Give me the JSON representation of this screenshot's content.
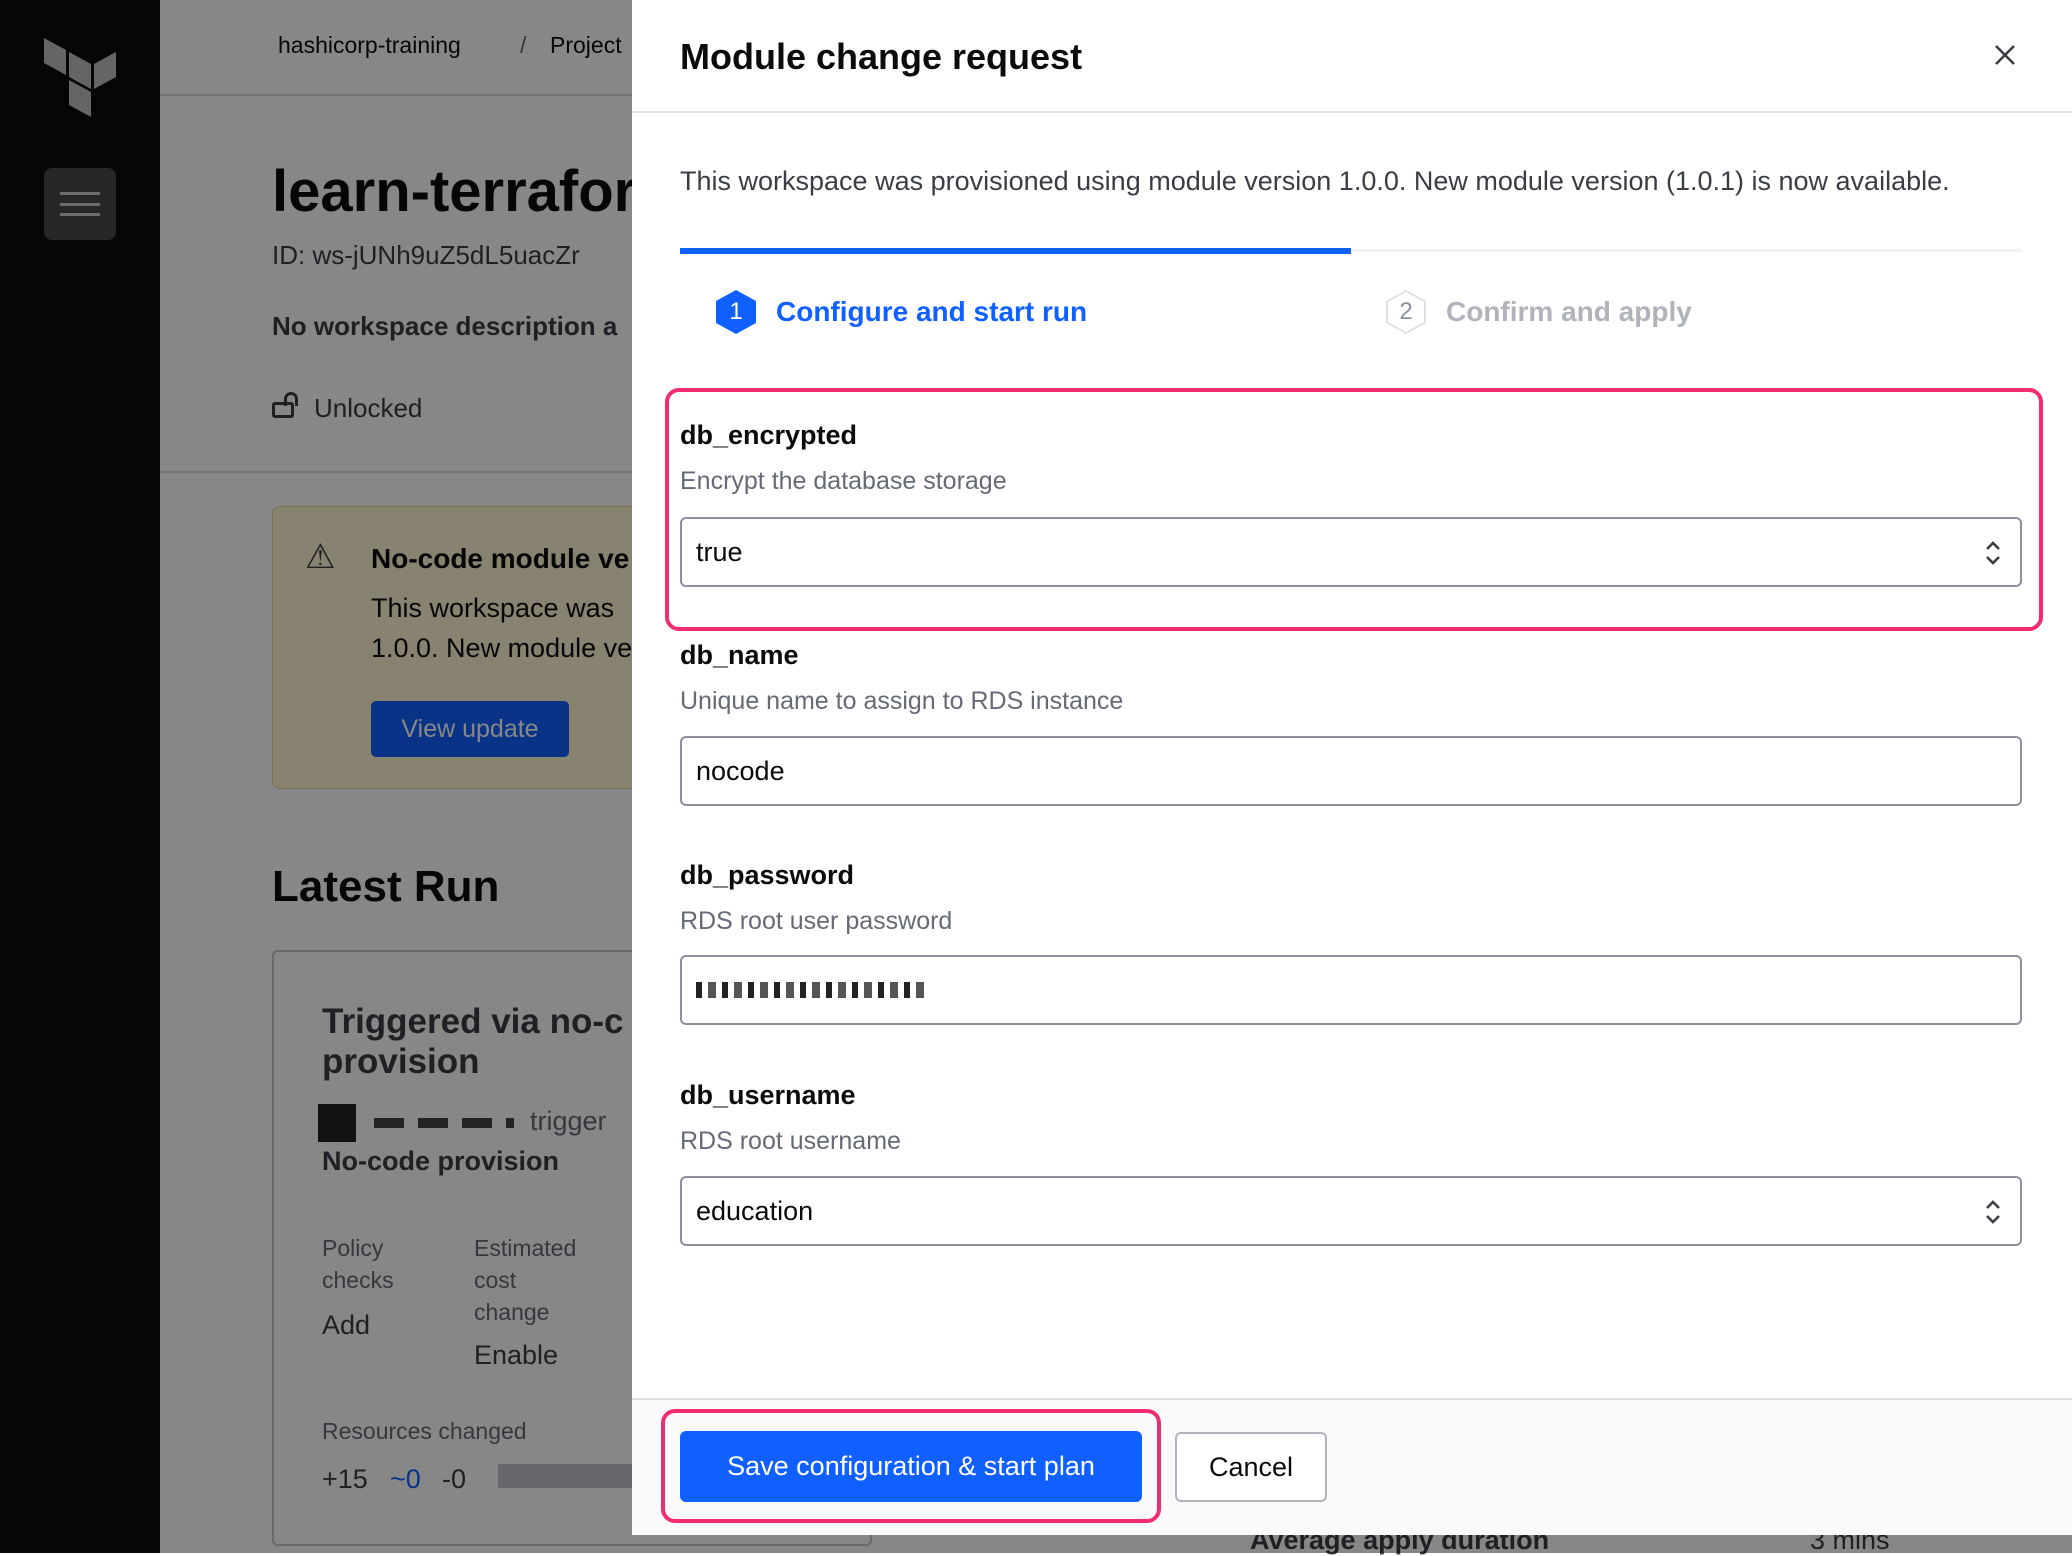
{
  "sidebar": {
    "logo": "terraform-logo",
    "menu_icon": "hamburger-icon"
  },
  "background": {
    "breadcrumb": [
      "hashicorp-training",
      "/",
      "Project"
    ],
    "workspace_title": "learn-terraform",
    "workspace_id": "ID: ws-jUNh9uZ5dL5uacZr",
    "description": "No workspace description a",
    "lock_status": "Unlocked",
    "alert": {
      "title": "No-code module ve",
      "line1": "This workspace was",
      "line2": "1.0.0. New module ve",
      "button": "View update"
    },
    "latest_run": {
      "heading": "Latest Run",
      "title_line1": "Triggered via no-c",
      "title_line2": "provision",
      "triggered": "trigger",
      "source": "No-code provision",
      "policy_label_1": "Policy",
      "policy_label_2": "checks",
      "policy_value": "Add",
      "cost_label_1": "Estimated",
      "cost_label_2": "cost",
      "cost_label_3": "change",
      "cost_value": "Enable",
      "resources_label": "Resources changed",
      "added": "+15",
      "changed": "~0",
      "destroyed": "-0"
    },
    "average_apply": "Average apply duration",
    "average_apply_value": "3 mins"
  },
  "modal": {
    "title": "Module change request",
    "intro": "This workspace was provisioned using module version 1.0.0. New module version (1.0.1) is now available.",
    "progress_percent": 50,
    "steps": [
      {
        "number": "1",
        "label": "Configure and start run",
        "state": "active"
      },
      {
        "number": "2",
        "label": "Confirm and apply",
        "state": "inactive"
      }
    ],
    "fields": [
      {
        "name": "db_encrypted",
        "description": "Encrypt the database storage",
        "value": "true",
        "type": "select"
      },
      {
        "name": "db_name",
        "description": "Unique name to assign to RDS instance",
        "value": "nocode",
        "type": "text"
      },
      {
        "name": "db_password",
        "description": "RDS root user password",
        "value": "",
        "type": "password-redacted"
      },
      {
        "name": "db_username",
        "description": "RDS root username",
        "value": "education",
        "type": "select"
      }
    ],
    "save_button": "Save configuration & start plan",
    "cancel_button": "Cancel"
  },
  "colors": {
    "accent": "#1060ff",
    "highlight": "#f22c72",
    "sidebar": "#0c0c0e"
  }
}
